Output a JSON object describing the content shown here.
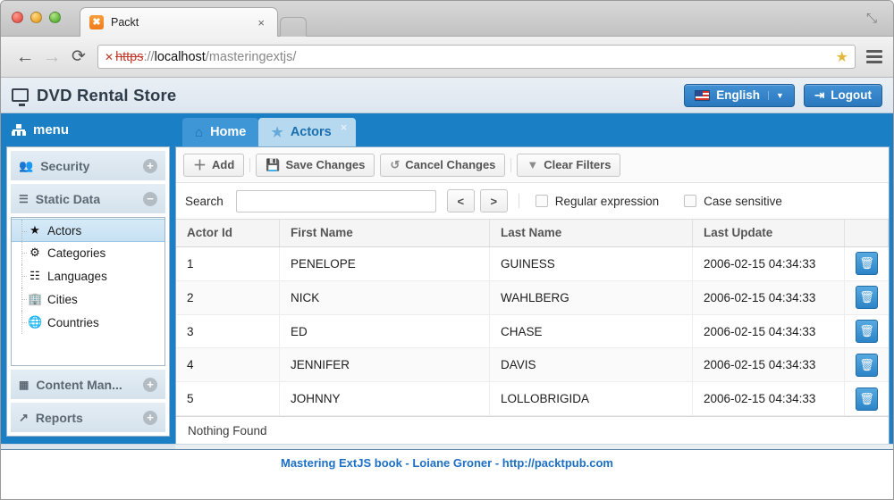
{
  "browser": {
    "tab_title": "Packt",
    "favicon_glyph": "✖",
    "close_glyph": "×",
    "maximize_glyph": "⤡",
    "back_glyph": "←",
    "forward_glyph": "→",
    "reload_glyph": "⟳",
    "security_glyph": "✕",
    "url_scheme": "https",
    "url_separator": "://",
    "url_host": "localhost",
    "url_path": "/masteringextjs/",
    "bookmark_glyph": "★"
  },
  "app_header": {
    "title": "DVD Rental Store",
    "language_label": "English",
    "language_caret": "▼",
    "logout_label": "Logout",
    "logout_glyph": "⇥"
  },
  "sidebar": {
    "header_label": "menu",
    "groups": [
      {
        "label": "Security",
        "icon": "users-icon",
        "glyph": "👥",
        "tool": "+",
        "expanded": false
      },
      {
        "label": "Static Data",
        "icon": "database-icon",
        "glyph": "☲",
        "tool": "−",
        "expanded": true
      },
      {
        "label": "Content Man...",
        "icon": "film-icon",
        "glyph": "☷",
        "tool": "+",
        "expanded": false
      },
      {
        "label": "Reports",
        "icon": "chart-icon",
        "glyph": "↗",
        "tool": "+",
        "expanded": false
      }
    ],
    "tree_items": [
      {
        "label": "Actors",
        "glyph": "★",
        "selected": true
      },
      {
        "label": "Categories",
        "glyph": "⚙",
        "selected": false
      },
      {
        "label": "Languages",
        "glyph": "☷",
        "selected": false
      },
      {
        "label": "Cities",
        "glyph": "🏢",
        "selected": false
      },
      {
        "label": "Countries",
        "glyph": "🌐",
        "selected": false
      }
    ]
  },
  "tabs": [
    {
      "label": "Home",
      "glyph": "⌂",
      "active": false,
      "closable": false
    },
    {
      "label": "Actors",
      "glyph": "★",
      "active": true,
      "closable": true,
      "close_glyph": "×"
    }
  ],
  "toolbar": {
    "add_label": "Add",
    "add_glyph": "＋",
    "save_label": "Save Changes",
    "save_glyph": "💾",
    "cancel_label": "Cancel Changes",
    "cancel_glyph": "↺",
    "clear_label": "Clear Filters",
    "clear_glyph": "▼"
  },
  "search": {
    "label": "Search",
    "value": "",
    "placeholder": "",
    "prev_label": "<",
    "next_label": ">",
    "regex_label": "Regular expression",
    "regex_checked": false,
    "case_label": "Case sensitive",
    "case_checked": false
  },
  "grid": {
    "columns": [
      "Actor Id",
      "First Name",
      "Last Name",
      "Last Update",
      ""
    ],
    "rows": [
      {
        "id": "1",
        "first": "PENELOPE",
        "last": "GUINESS",
        "updated": "2006-02-15 04:34:33",
        "delete_glyph": "🗑"
      },
      {
        "id": "2",
        "first": "NICK",
        "last": "WAHLBERG",
        "updated": "2006-02-15 04:34:33",
        "delete_glyph": "🗑"
      },
      {
        "id": "3",
        "first": "ED",
        "last": "CHASE",
        "updated": "2006-02-15 04:34:33",
        "delete_glyph": "🗑"
      },
      {
        "id": "4",
        "first": "JENNIFER",
        "last": "DAVIS",
        "updated": "2006-02-15 04:34:33",
        "delete_glyph": "🗑"
      },
      {
        "id": "5",
        "first": "JOHNNY",
        "last": "LOLLOBRIGIDA",
        "updated": "2006-02-15 04:34:33",
        "delete_glyph": "🗑"
      }
    ],
    "status_text": "Nothing Found"
  },
  "footer": {
    "text": "Mastering ExtJS book - Loiane Groner - http://packtpub.com"
  },
  "colors": {
    "accent_blue": "#1a7fc5",
    "tab_active": "#b6d9f0",
    "tab_inactive": "#3f96d6",
    "footer_link": "#1c6fc4",
    "delete_button": "#2b84c8"
  }
}
